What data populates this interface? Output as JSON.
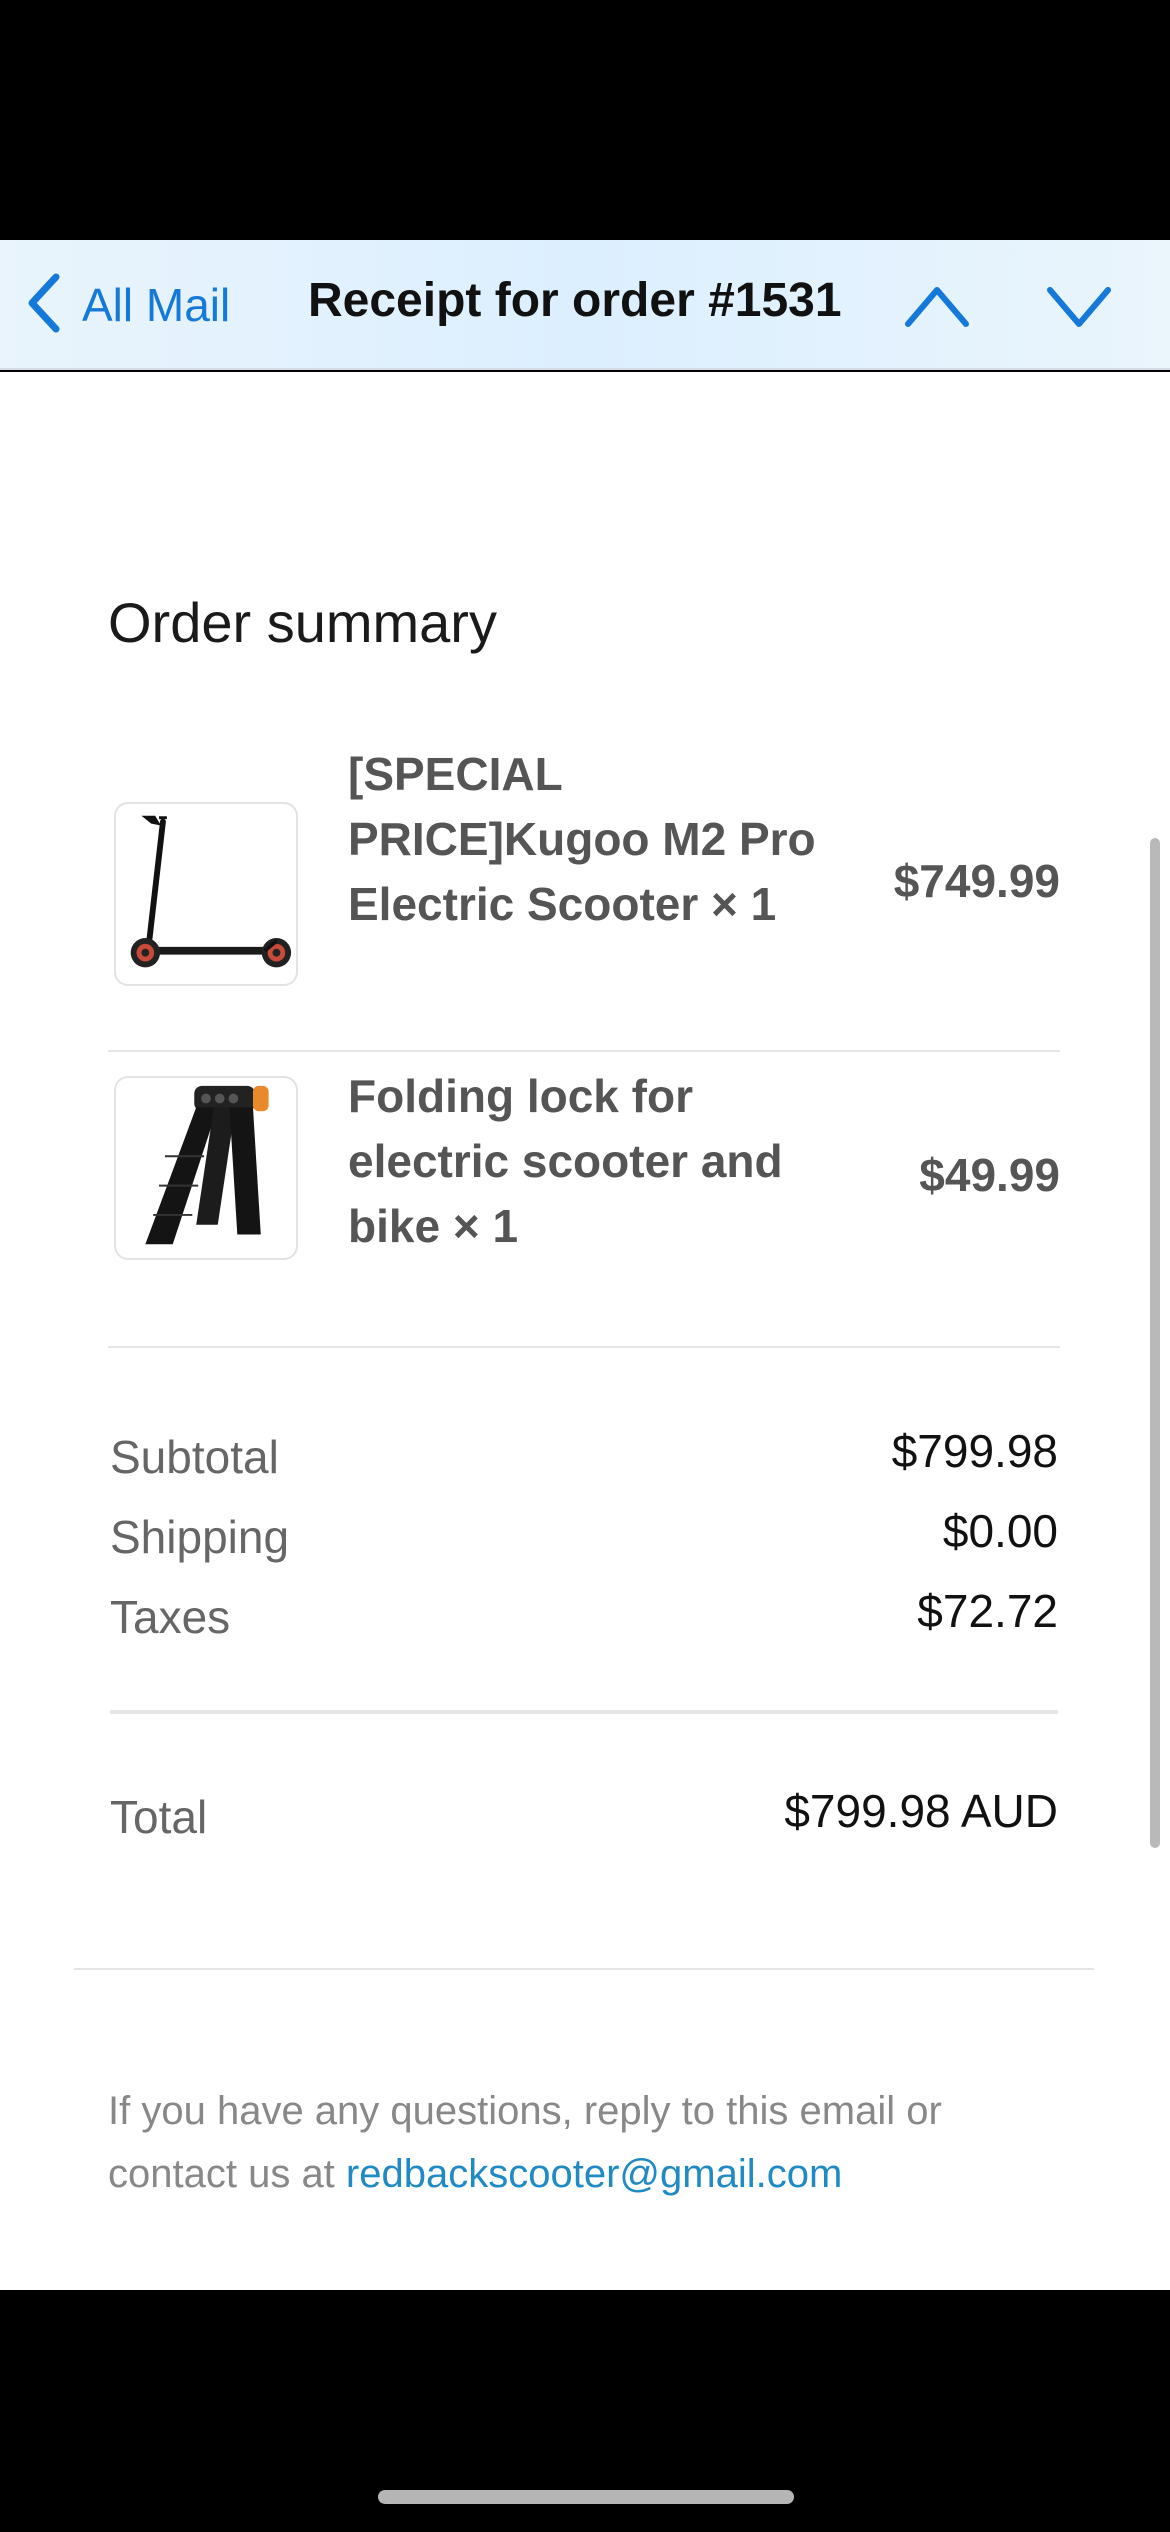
{
  "navbar": {
    "back_label": "All Mail",
    "title": "Receipt for order #1531",
    "accent_color": "#1479d8"
  },
  "summary": {
    "title": "Order summary"
  },
  "items": [
    {
      "name": "[SPECIAL PRICE]Kugoo M2 Pro Electric Scooter × 1",
      "price": "$749.99",
      "icon": "electric-scooter-image"
    },
    {
      "name": "Folding lock for electric scooter and bike × 1",
      "price": "$49.99",
      "icon": "folding-lock-image"
    }
  ],
  "totals": {
    "subtotal_label": "Subtotal",
    "subtotal_value": "$799.98",
    "shipping_label": "Shipping",
    "shipping_value": "$0.00",
    "taxes_label": "Taxes",
    "taxes_value": "$72.72",
    "total_label": "Total",
    "total_value": "$799.98 AUD"
  },
  "footer": {
    "text": "If you have any questions, reply to this email or contact us at ",
    "email": "redbackscooter@gmail.com",
    "link_color": "#1f8ac4"
  }
}
